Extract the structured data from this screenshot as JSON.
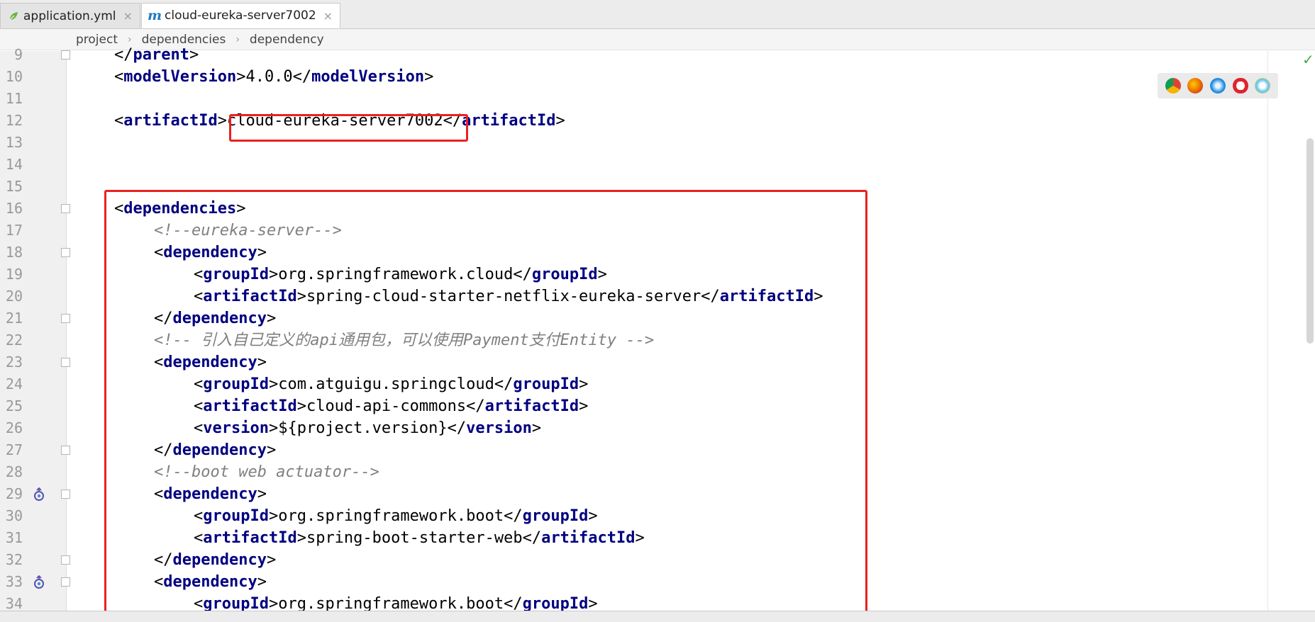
{
  "tabs": [
    {
      "label": "application.yml",
      "icon": "spring-leaf-icon",
      "active": false
    },
    {
      "label": "cloud-eureka-server7002",
      "icon": "maven-icon",
      "active": true
    }
  ],
  "breadcrumb": [
    "project",
    "dependencies",
    "dependency"
  ],
  "lines": [
    {
      "n": "9",
      "g": [
        [
          "b",
          "</"
        ],
        [
          "t",
          "parent"
        ],
        [
          "b",
          ">"
        ]
      ]
    },
    {
      "n": "10",
      "g": [
        [
          "b",
          "<"
        ],
        [
          "t",
          "modelVersion"
        ],
        [
          "b",
          ">4.0.0</"
        ],
        [
          "t",
          "modelVersion"
        ],
        [
          "b",
          ">"
        ]
      ]
    },
    {
      "n": "11",
      "g": []
    },
    {
      "n": "12",
      "g": [
        [
          "b",
          "<"
        ],
        [
          "t",
          "artifactId"
        ],
        [
          "b",
          ">cloud-eureka-server7002</"
        ],
        [
          "t",
          "artifactId"
        ],
        [
          "b",
          ">"
        ]
      ]
    },
    {
      "n": "13",
      "g": []
    },
    {
      "n": "14",
      "g": []
    },
    {
      "n": "15",
      "g": []
    },
    {
      "n": "16",
      "g": [
        [
          "b",
          "<"
        ],
        [
          "t",
          "dependencies"
        ],
        [
          "b",
          ">"
        ]
      ]
    },
    {
      "n": "17",
      "g": [
        [
          "c",
          "<!--eureka-server-->"
        ]
      ]
    },
    {
      "n": "18",
      "g": [
        [
          "b",
          "<"
        ],
        [
          "t",
          "dependency"
        ],
        [
          "b",
          ">"
        ]
      ]
    },
    {
      "n": "19",
      "g": [
        [
          "b",
          "<"
        ],
        [
          "t",
          "groupId"
        ],
        [
          "b",
          ">org.springframework.cloud</"
        ],
        [
          "t",
          "groupId"
        ],
        [
          "b",
          ">"
        ]
      ]
    },
    {
      "n": "20",
      "g": [
        [
          "b",
          "<"
        ],
        [
          "t",
          "artifactId"
        ],
        [
          "b",
          ">spring-cloud-starter-netflix-eureka-server</"
        ],
        [
          "t",
          "artifactId"
        ],
        [
          "b",
          ">"
        ]
      ]
    },
    {
      "n": "21",
      "g": [
        [
          "b",
          "</"
        ],
        [
          "t",
          "dependency"
        ],
        [
          "b",
          ">"
        ]
      ]
    },
    {
      "n": "22",
      "g": [
        [
          "c",
          "<!-- 引入自己定义的api通用包，可以使用Payment支付Entity -->"
        ]
      ]
    },
    {
      "n": "23",
      "g": [
        [
          "b",
          "<"
        ],
        [
          "t",
          "dependency"
        ],
        [
          "b",
          ">"
        ]
      ]
    },
    {
      "n": "24",
      "g": [
        [
          "b",
          "<"
        ],
        [
          "t",
          "groupId"
        ],
        [
          "b",
          ">com.atguigu.springcloud</"
        ],
        [
          "t",
          "groupId"
        ],
        [
          "b",
          ">"
        ]
      ]
    },
    {
      "n": "25",
      "g": [
        [
          "b",
          "<"
        ],
        [
          "t",
          "artifactId"
        ],
        [
          "b",
          ">cloud-api-commons</"
        ],
        [
          "t",
          "artifactId"
        ],
        [
          "b",
          ">"
        ]
      ]
    },
    {
      "n": "26",
      "g": [
        [
          "b",
          "<"
        ],
        [
          "t",
          "version"
        ],
        [
          "b",
          ">${project.version}</"
        ],
        [
          "t",
          "version"
        ],
        [
          "b",
          ">"
        ]
      ]
    },
    {
      "n": "27",
      "g": [
        [
          "b",
          "</"
        ],
        [
          "t",
          "dependency"
        ],
        [
          "b",
          ">"
        ]
      ]
    },
    {
      "n": "28",
      "g": [
        [
          "c",
          "<!--boot web actuator-->"
        ]
      ]
    },
    {
      "n": "29",
      "g": [
        [
          "b",
          "<"
        ],
        [
          "t",
          "dependency"
        ],
        [
          "b",
          ">"
        ]
      ]
    },
    {
      "n": "30",
      "g": [
        [
          "b",
          "<"
        ],
        [
          "t",
          "groupId"
        ],
        [
          "b",
          ">org.springframework.boot</"
        ],
        [
          "t",
          "groupId"
        ],
        [
          "b",
          ">"
        ]
      ]
    },
    {
      "n": "31",
      "g": [
        [
          "b",
          "<"
        ],
        [
          "t",
          "artifactId"
        ],
        [
          "b",
          ">spring-boot-starter-web</"
        ],
        [
          "t",
          "artifactId"
        ],
        [
          "b",
          ">"
        ]
      ]
    },
    {
      "n": "32",
      "g": [
        [
          "b",
          "</"
        ],
        [
          "t",
          "dependency"
        ],
        [
          "b",
          ">"
        ]
      ]
    },
    {
      "n": "33",
      "g": [
        [
          "b",
          "<"
        ],
        [
          "t",
          "dependency"
        ],
        [
          "b",
          ">"
        ]
      ]
    },
    {
      "n": "34",
      "g": [
        [
          "b",
          "<"
        ],
        [
          "t",
          "groupId"
        ],
        [
          "b",
          ">org.springframework.boot</"
        ],
        [
          "t",
          "groupId"
        ],
        [
          "b",
          ">"
        ]
      ]
    }
  ],
  "browser_icons": [
    "chrome-icon",
    "firefox-icon",
    "safari-icon",
    "opera-icon",
    "ie-icon"
  ],
  "colors": {
    "tag": "#000080",
    "comment": "#808080",
    "highlight_box": "#e8221f"
  }
}
